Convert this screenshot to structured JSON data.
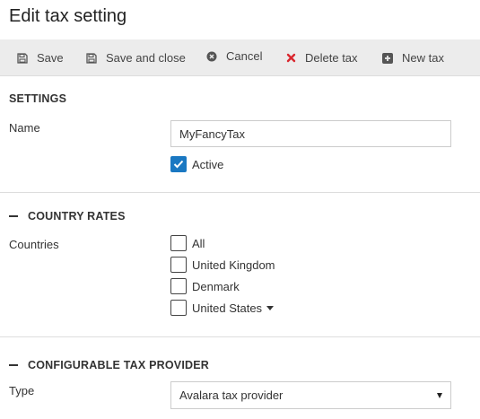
{
  "header": {
    "title": "Edit tax setting"
  },
  "toolbar": {
    "save": {
      "label": "Save",
      "icon": "floppy-disk-icon"
    },
    "save_close": {
      "label": "Save and close",
      "icon": "floppy-disk-icon"
    },
    "cancel": {
      "label": "Cancel",
      "icon": "times-circle-icon"
    },
    "delete": {
      "label": "Delete tax",
      "icon": "red-x-icon",
      "icon_color": "#d9272e"
    },
    "new": {
      "label": "New tax",
      "icon": "plus-square-icon"
    }
  },
  "settings": {
    "title": "SETTINGS",
    "name_label": "Name",
    "name_value": "MyFancyTax",
    "active_label": "Active",
    "active_checked": true
  },
  "country_rates": {
    "title": "COUNTRY RATES",
    "countries_label": "Countries",
    "options": [
      {
        "label": "All",
        "checked": false
      },
      {
        "label": "United Kingdom",
        "checked": false
      },
      {
        "label": "Denmark",
        "checked": false
      },
      {
        "label": "United States",
        "checked": false,
        "expandable": true
      }
    ]
  },
  "tax_provider": {
    "title": "CONFIGURABLE TAX PROVIDER",
    "type_label": "Type",
    "type_value": "Avalara tax provider"
  },
  "colors": {
    "accent": "#1a78c2",
    "toolbar_bg": "#ececec",
    "danger": "#d9272e"
  }
}
